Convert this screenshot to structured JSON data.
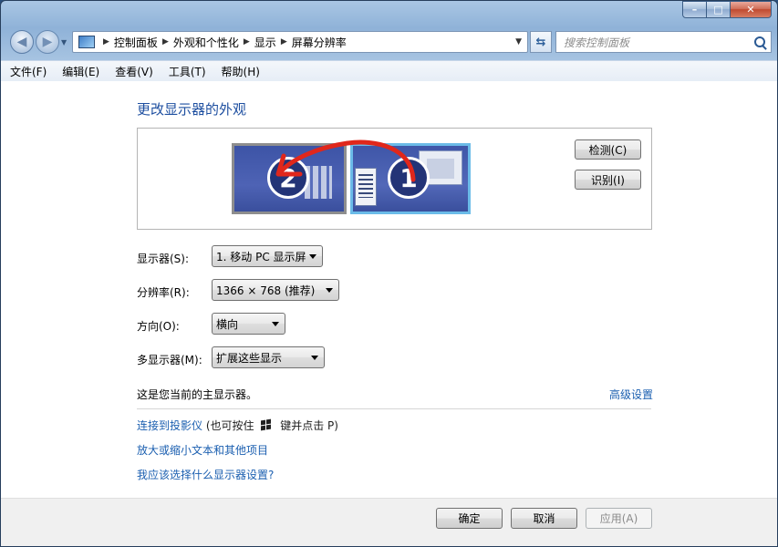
{
  "window": {
    "caption": {
      "minimize": "–",
      "maximize": "□",
      "close": "✕"
    }
  },
  "nav": {
    "back_icon": "back-arrow-icon",
    "forward_icon": "forward-arrow-icon",
    "breadcrumb": [
      "控制面板",
      "外观和个性化",
      "显示",
      "屏幕分辨率"
    ],
    "search_placeholder": "搜索控制面板"
  },
  "menu": {
    "items": [
      "文件(F)",
      "编辑(E)",
      "查看(V)",
      "工具(T)",
      "帮助(H)"
    ]
  },
  "main": {
    "title": "更改显示器的外观",
    "monitor_labels": [
      "2",
      "1"
    ],
    "detect_label": "检测(C)",
    "identify_label": "识别(I)",
    "display_label": "显示器(S):",
    "display_value": "1. 移动 PC 显示屏",
    "resolution_label": "分辨率(R):",
    "resolution_value": "1366 × 768 (推荐)",
    "orientation_label": "方向(O):",
    "orientation_value": "横向",
    "multi_label": "多显示器(M):",
    "multi_value": "扩展这些显示",
    "primary_note": "这是您当前的主显示器。",
    "advanced_link": "高级设置",
    "projector_link": "连接到投影仪",
    "projector_hint_pre": "(也可按住",
    "projector_hint_post": "键并点击 P)",
    "zoom_link": "放大或缩小文本和其他项目",
    "help_link": "我应该选择什么显示器设置?"
  },
  "footer": {
    "ok_label": "确定",
    "cancel_label": "取消",
    "apply_label": "应用(A)"
  },
  "colors": {
    "accent": "#1e4fa0",
    "link": "#1b5fb0",
    "arrow": "#e0271b"
  }
}
